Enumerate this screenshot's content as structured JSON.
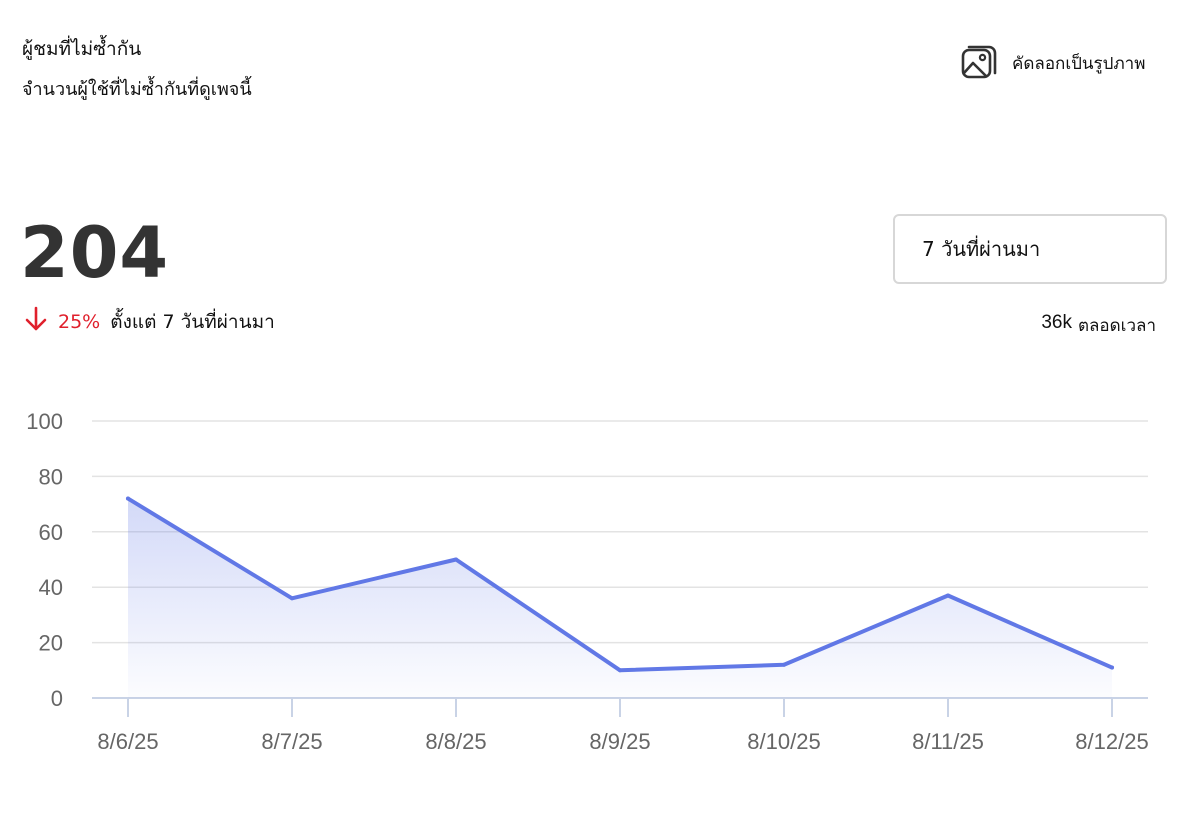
{
  "header": {
    "title": "ผู้ชมที่ไม่ซ้ำกัน",
    "subtitle": "จำนวนผู้ใช้ที่ไม่ซ้ำกันที่ดูเพจนี้",
    "copy_button_label": "คัดลอกเป็นรูปภาพ",
    "copy_icon": "image-icon"
  },
  "summary": {
    "value": "204",
    "change_percent": "25%",
    "change_direction": "down",
    "change_text": "ตั้งแต่ 7 วันที่ผ่านมา",
    "down_color": "#e0202c"
  },
  "range": {
    "selected": "7 วันที่ผ่านมา"
  },
  "lifetime": {
    "value": "36k",
    "label": "ตลอดเวลา"
  },
  "chart_data": {
    "type": "area",
    "categories": [
      "8/6/25",
      "8/7/25",
      "8/8/25",
      "8/9/25",
      "8/10/25",
      "8/11/25",
      "8/12/25"
    ],
    "series": [
      {
        "values": [
          72,
          36,
          50,
          10,
          12,
          37,
          11
        ],
        "color": "#6178e6"
      }
    ],
    "y_ticks": [
      "0",
      "20",
      "40",
      "60",
      "80",
      "100"
    ],
    "ylim": [
      0,
      100
    ],
    "grid": true,
    "xlabel": "",
    "ylabel": "",
    "title": ""
  }
}
